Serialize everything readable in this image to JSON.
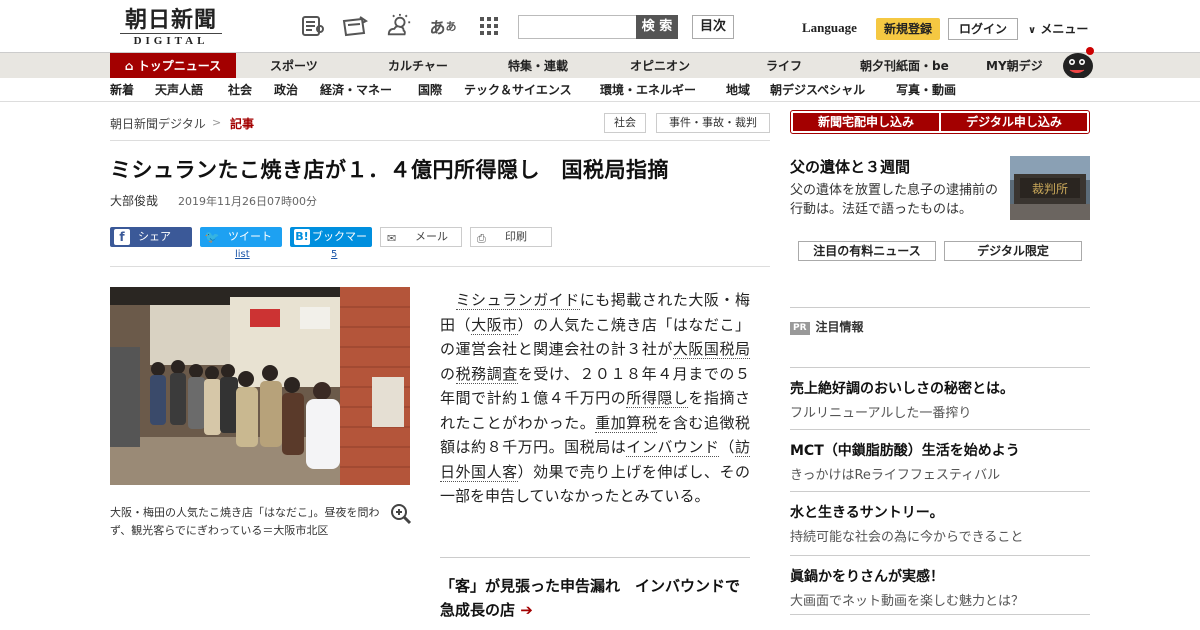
{
  "header": {
    "logo_main": "朝日新聞",
    "logo_sub": "DIGITAL",
    "search_button": "検 索",
    "mokuji_button": "目次",
    "language": "Language",
    "register": "新規登録",
    "login": "ログイン",
    "menu": "メニュー"
  },
  "nav1": {
    "items": [
      "トップニュース",
      "スポーツ",
      "カルチャー",
      "特集・連載",
      "オピニオン",
      "ライフ",
      "朝夕刊紙面・be",
      "MY朝デジ"
    ]
  },
  "nav2": {
    "items": [
      "新着",
      "天声人語",
      "社会",
      "政治",
      "経済・マネー",
      "国際",
      "テック＆サイエンス",
      "環境・エネルギー",
      "地域",
      "朝デジスペシャル",
      "写真・動画"
    ]
  },
  "breadcrumb": {
    "home": "朝日新聞デジタル",
    "separator": ">",
    "current": "記事",
    "tags": [
      "社会",
      "事件・事故・裁判"
    ]
  },
  "article": {
    "headline": "ミシュランたこ焼き店が１．４億円所得隠し　国税局指摘",
    "author": "大部俊哉",
    "date": "2019年11月26日07時00分",
    "share": {
      "facebook": "シェア",
      "twitter": "ツイート",
      "twitter_count": "list",
      "hatena": "ブックマーク",
      "hatena_count": "5",
      "mail": "メール",
      "print": "印刷"
    },
    "caption": "大阪・梅田の人気たこ焼き店「はなだこ」。昼夜を問わず、観光客らでにぎわっている＝大阪市北区",
    "body": {
      "indent": "　",
      "kw1": "ミシュランガイド",
      "t1": "にも掲載された大阪・梅田（",
      "kw2": "大阪市",
      "t2": "）の人気たこ焼き店「はなだこ」の運営会社と関連会社の計３社が",
      "kw3": "大阪国税局",
      "t3": "の",
      "kw4": "税務調査",
      "t4": "を受け、２０１８年４月までの５年間で計約１億４千万円の",
      "kw5": "所得隠し",
      "t5": "を指摘されたことがわかった。",
      "kw6": "重加算税",
      "t6": "を含む追徴税額は約８千万円。国税局は",
      "kw7": "インバウンド",
      "t7": "（",
      "kw8": "訪日外国人客",
      "t8": "）効果で売り上げを伸ばし、その一部を申告していなかったとみている。"
    },
    "related": "「客」が見張った申告漏れ　インバウンドで急成長の店"
  },
  "sidebar": {
    "subscribe_paper": "新聞宅配申し込み",
    "subscribe_digital": "デジタル申し込み",
    "feature_title": "父の遺体と３週間",
    "feature_desc": "父の遺体を放置した息子の逮捕前の行動は。法廷で語ったものは。",
    "tab_paid": "注目の有料ニュース",
    "tab_digital": "デジタル限定",
    "pr_badge": "PR",
    "pr_heading": "注目情報",
    "pr_items": [
      {
        "title": "売上絶好調のおいしさの秘密とは。",
        "sub": "フルリニューアルした一番搾り"
      },
      {
        "title": "MCT（中鎖脂肪酸）生活を始めよう",
        "sub": "きっかけはReライフフェスティバル"
      },
      {
        "title": "水と生きるサントリー。",
        "sub": "持続可能な社会の為に今からできること"
      },
      {
        "title": "眞鍋かをりさんが実感！",
        "sub": "大画面でネット動画を楽しむ魅力とは？"
      }
    ]
  },
  "colors": {
    "brand_red": "#a30000",
    "register_yellow": "#f5c842",
    "facebook": "#3b5998",
    "twitter": "#1da1f2",
    "hatena": "#008fde"
  }
}
